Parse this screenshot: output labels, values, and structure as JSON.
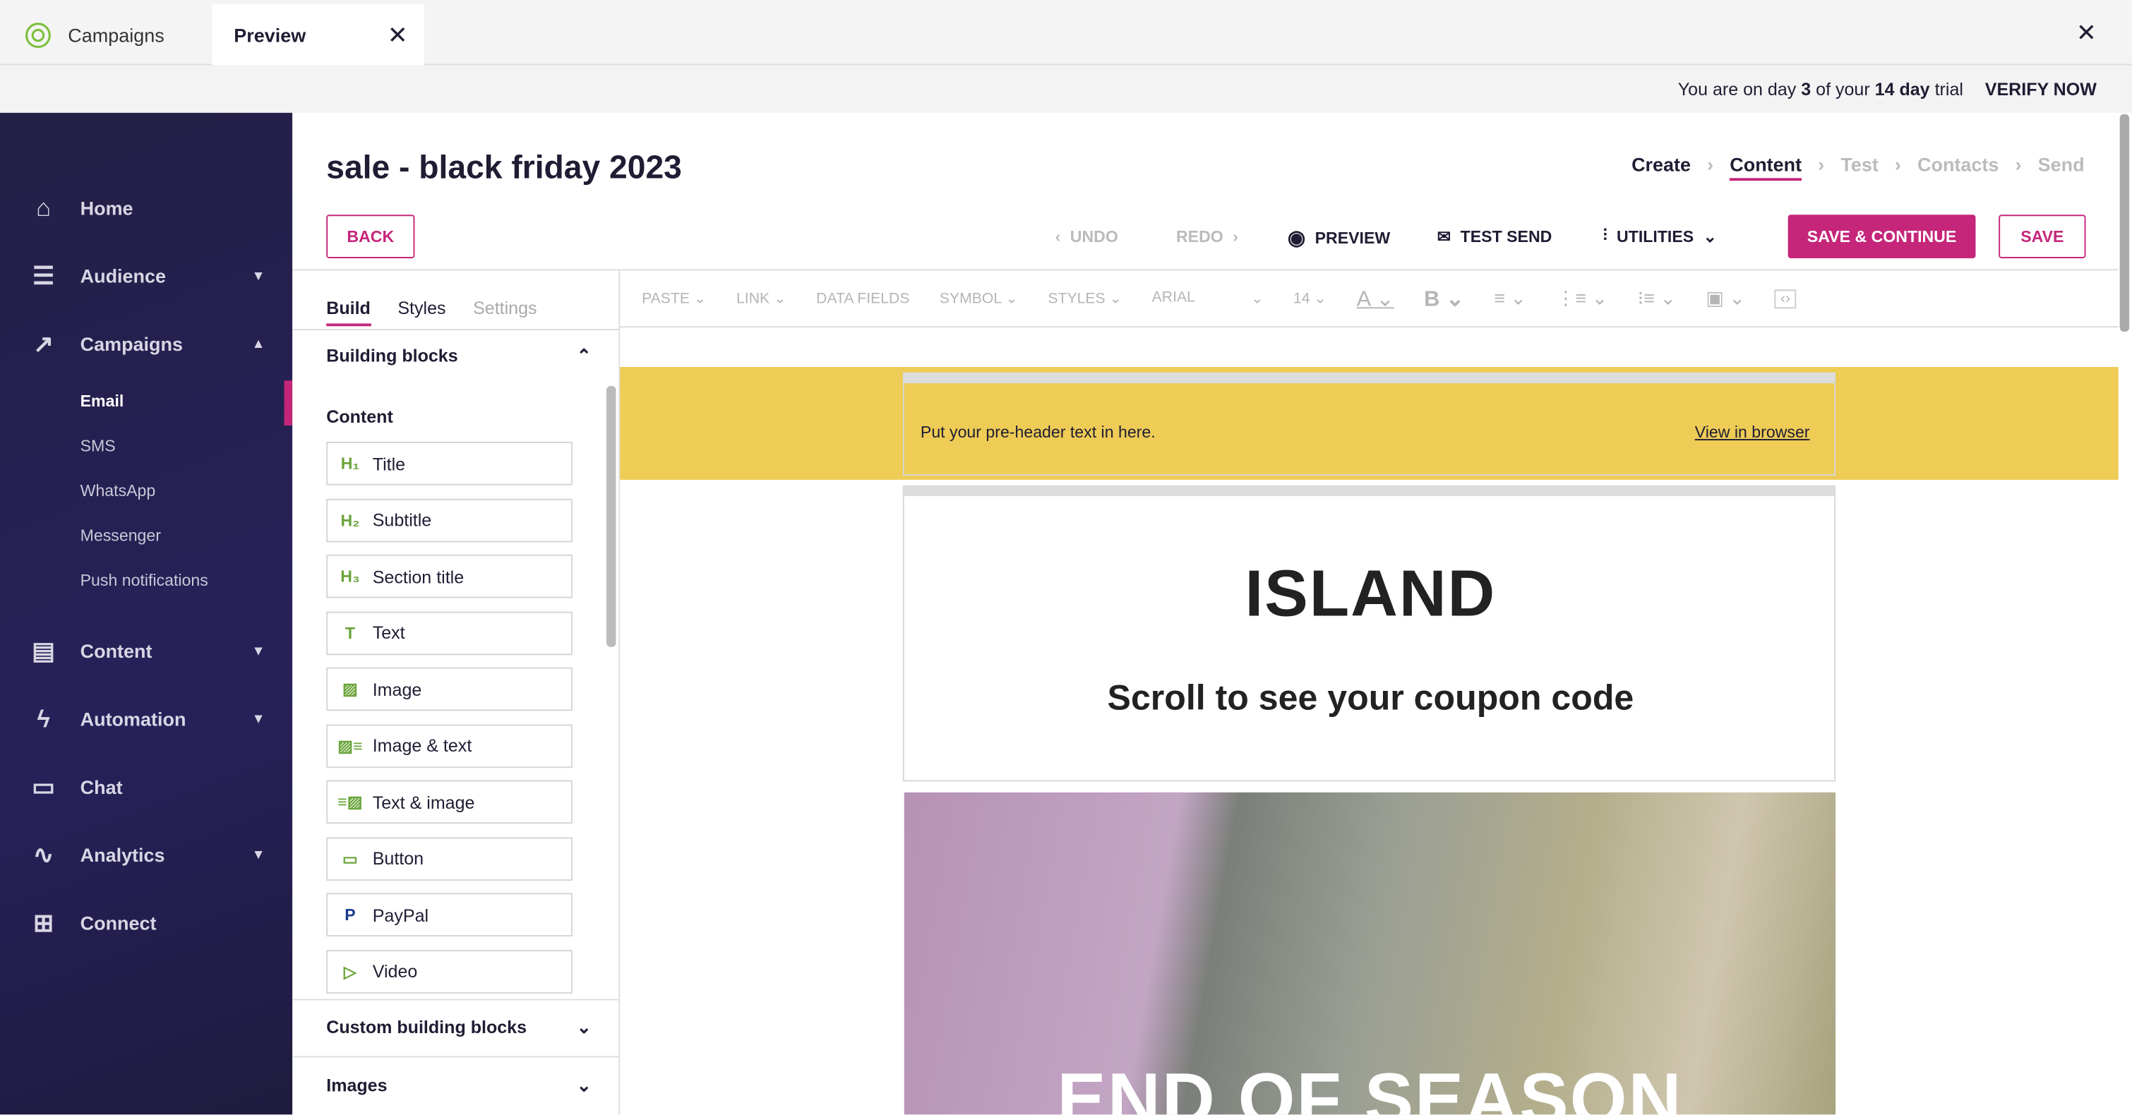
{
  "tabs": [
    {
      "label": "Campaigns",
      "icon": "campaigns-logo-icon"
    },
    {
      "label": "Preview",
      "active": true
    }
  ],
  "trial": {
    "pre": "You are on day ",
    "day": "3",
    "mid": " of your ",
    "total": "14 day",
    "post": " trial",
    "verify": "VERIFY NOW"
  },
  "sidebar": {
    "items": [
      {
        "label": "Home",
        "icon": "home-icon"
      },
      {
        "label": "Audience",
        "icon": "audience-icon",
        "chevron": "down"
      },
      {
        "label": "Campaigns",
        "icon": "campaigns-icon",
        "chevron": "up"
      },
      {
        "label": "Content",
        "icon": "content-icon",
        "chevron": "down"
      },
      {
        "label": "Automation",
        "icon": "automation-icon",
        "chevron": "down"
      },
      {
        "label": "Chat",
        "icon": "chat-icon"
      },
      {
        "label": "Analytics",
        "icon": "analytics-icon",
        "chevron": "down"
      },
      {
        "label": "Connect",
        "icon": "connect-icon"
      }
    ],
    "sub": [
      "Email",
      "SMS",
      "WhatsApp",
      "Messenger",
      "Push notifications"
    ]
  },
  "header": {
    "title": "sale - black friday 2023",
    "steps": [
      "Create",
      "Content",
      "Test",
      "Contacts",
      "Send"
    ],
    "active_step": "Content"
  },
  "toolbar": {
    "back": "BACK",
    "undo": "UNDO",
    "redo": "REDO",
    "preview": "PREVIEW",
    "test_send": "TEST SEND",
    "utilities": "UTILITIES",
    "save_continue": "SAVE & CONTINUE",
    "save": "SAVE"
  },
  "format": {
    "paste": "PASTE",
    "link": "LINK",
    "data_fields": "DATA FIELDS",
    "symbol": "SYMBOL",
    "styles": "STYLES",
    "font": "ARIAL",
    "size": "14"
  },
  "panel": {
    "tabs": [
      "Build",
      "Styles",
      "Settings"
    ],
    "section": "Building blocks",
    "group": "Content",
    "blocks": [
      {
        "label": "Title",
        "icon": "h1-icon"
      },
      {
        "label": "Subtitle",
        "icon": "h2-icon"
      },
      {
        "label": "Section title",
        "icon": "h3-icon"
      },
      {
        "label": "Text",
        "icon": "text-icon"
      },
      {
        "label": "Image",
        "icon": "image-icon"
      },
      {
        "label": "Image & text",
        "icon": "image-text-icon"
      },
      {
        "label": "Text & image",
        "icon": "text-image-icon"
      },
      {
        "label": "Button",
        "icon": "button-icon"
      },
      {
        "label": "PayPal",
        "icon": "paypal-icon"
      },
      {
        "label": "Video",
        "icon": "video-icon"
      }
    ],
    "custom": "Custom building blocks",
    "images": "Images"
  },
  "email": {
    "preheader": "Put your pre-header text in here.",
    "view_browser": "View in browser",
    "logo": "ISLAND",
    "heading": "Scroll to see your coupon code",
    "hero_text": "END OF SEASON"
  },
  "colors": {
    "accent": "#c5267a",
    "sidebar": "#232046",
    "preheader_bg": "#eecc55",
    "green": "#6aa43a"
  }
}
